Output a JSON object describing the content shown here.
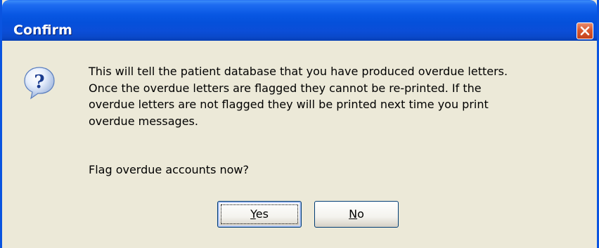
{
  "window": {
    "title": "Confirm",
    "close_icon": "close-icon",
    "accent_color": "#0054e3",
    "close_color": "#d9582f"
  },
  "dialog": {
    "icon": "question-icon",
    "message": "This will tell the patient database that you have produced overdue letters.\nOnce the overdue letters are flagged they cannot be re-printed. If the\noverdue letters are not flagged they will be printed next time you print\noverdue messages.",
    "prompt": "Flag overdue accounts now?"
  },
  "buttons": {
    "yes": {
      "mnemonic": "Y",
      "rest": "es"
    },
    "no": {
      "mnemonic": "N",
      "rest": "o"
    }
  }
}
